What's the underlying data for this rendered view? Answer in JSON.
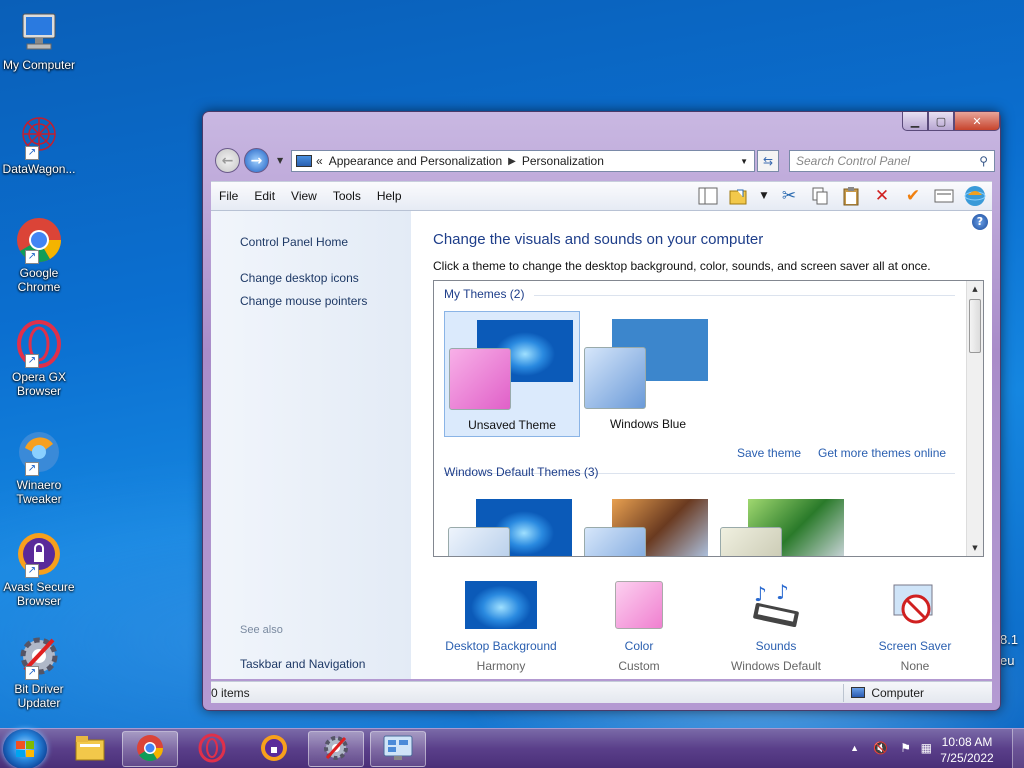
{
  "desktop": {
    "icons": [
      {
        "label": "My Computer"
      },
      {
        "label": "DataWagon..."
      },
      {
        "label": "Google Chrome"
      },
      {
        "label": "Opera GX Browser"
      },
      {
        "label": "Winaero Tweaker"
      },
      {
        "label": "Avast Secure Browser"
      },
      {
        "label": "Bit Driver Updater"
      }
    ],
    "edge_text_1": "8.1",
    "edge_text_2": "eu"
  },
  "window": {
    "address": {
      "prefix": "«",
      "crumbs": [
        "Appearance and Personalization",
        "Personalization"
      ]
    },
    "search_placeholder": "Search Control Panel",
    "menu": [
      "File",
      "Edit",
      "View",
      "Tools",
      "Help"
    ],
    "toolbar_icons": [
      "layout-icon",
      "folder-options-icon",
      "dropdown-icon",
      "cut-icon",
      "copy-icon",
      "paste-icon",
      "delete-icon",
      "check-icon",
      "properties-icon",
      "globe-icon"
    ],
    "left_pane": {
      "home": "Control Panel Home",
      "links": [
        "Change desktop icons",
        "Change mouse pointers"
      ],
      "see_also_label": "See also",
      "see_also_links": [
        "Taskbar and Navigation"
      ]
    },
    "content": {
      "title": "Change the visuals and sounds on your computer",
      "subtitle": "Click a theme to change the desktop background, color, sounds, and screen saver all at once.",
      "my_themes_label": "My Themes (2)",
      "my_themes": [
        {
          "name": "Unsaved Theme",
          "selected": true
        },
        {
          "name": "Windows Blue",
          "selected": false
        }
      ],
      "save_theme": "Save theme",
      "get_more": "Get more themes online",
      "default_themes_label": "Windows Default Themes (3)",
      "bottom": [
        {
          "name": "Desktop Background",
          "value": "Harmony"
        },
        {
          "name": "Color",
          "value": "Custom"
        },
        {
          "name": "Sounds",
          "value": "Windows Default"
        },
        {
          "name": "Screen Saver",
          "value": "None"
        }
      ]
    },
    "status": {
      "items": "0 items",
      "location": "Computer"
    }
  },
  "taskbar": {
    "clock_time": "10:08 AM",
    "clock_date": "7/25/2022",
    "buttons": [
      "file-explorer",
      "google-chrome",
      "opera-gx",
      "avast-secure-browser",
      "bit-driver-updater",
      "control-panel"
    ]
  },
  "colors": {
    "accent": "#1e3e8a",
    "link": "#2a5fb0",
    "selected_tile": "#dbeafc",
    "unsaved_color_swatch": "#f080d0",
    "windows_blue_swatch": "#3c86cc"
  }
}
